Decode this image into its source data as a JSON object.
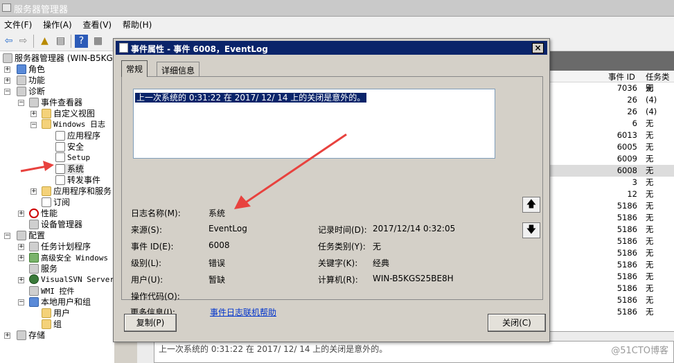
{
  "window": {
    "title": "服务器管理器"
  },
  "menu": [
    "文件(F)",
    "操作(A)",
    "查看(V)",
    "帮助(H)"
  ],
  "tree": {
    "root": "服务器管理器 (WIN-B5KGS2",
    "roles": "角色",
    "features": "功能",
    "diagnostics": "诊断",
    "event_viewer": "事件查看器",
    "custom_views": "自定义视图",
    "windows_logs": "Windows 日志",
    "application": "应用程序",
    "security": "安全",
    "setup": "Setup",
    "system": "系统",
    "forwarded": "转发事件",
    "apps_services": "应用程序和服务",
    "subscriptions": "订阅",
    "performance": "性能",
    "device_manager": "设备管理器",
    "configuration": "配置",
    "task_scheduler": "任务计划程序",
    "firewall": "高级安全 Windows",
    "services": "服务",
    "visualsvn": "VisualSVN Server",
    "wmi": "WMI 控件",
    "local_users": "本地用户和组",
    "users": "用户",
    "groups": "组",
    "storage": "存储"
  },
  "list": {
    "headers": {
      "event_id": "事件 ID",
      "category": "任务类别"
    },
    "rows": [
      {
        "id": "7036",
        "cat": "无"
      },
      {
        "id": "26",
        "cat": "(4)"
      },
      {
        "id": "26",
        "cat": "(4)"
      },
      {
        "id": "6",
        "cat": "无"
      },
      {
        "id": "6013",
        "cat": "无"
      },
      {
        "id": "6005",
        "cat": "无"
      },
      {
        "id": "6009",
        "cat": "无"
      },
      {
        "id": "6008",
        "cat": "无"
      },
      {
        "id": "3",
        "cat": "无"
      },
      {
        "id": "12",
        "cat": "无"
      },
      {
        "id": "5186",
        "cat": "无"
      },
      {
        "id": "5186",
        "cat": "无"
      },
      {
        "id": "5186",
        "cat": "无"
      },
      {
        "id": "5186",
        "cat": "无"
      },
      {
        "id": "5186",
        "cat": "无"
      },
      {
        "id": "5186",
        "cat": "无"
      },
      {
        "id": "5186",
        "cat": "无"
      },
      {
        "id": "5186",
        "cat": "无"
      },
      {
        "id": "5186",
        "cat": "无"
      },
      {
        "id": "5186",
        "cat": "无"
      }
    ]
  },
  "detail_preview": "上一次系统的 0:31:22 在  2017/  12/  14 上的关闭是意外的。",
  "dialog": {
    "title": "事件属性 - 事件 6008，EventLog",
    "close": "×",
    "tabs": [
      "常规",
      "详细信息"
    ],
    "description": "上一次系统的 0:31:22 在   2017/  12/  14 上的关闭是意外的。",
    "fields": {
      "log_name_label": "日志名称(M):",
      "log_name": "系统",
      "source_label": "来源(S):",
      "source": "EventLog",
      "logged_label": "记录时间(D):",
      "logged": "2017/12/14 0:32:05",
      "event_id_label": "事件 ID(E):",
      "event_id": "6008",
      "task_category_label": "任务类别(Y):",
      "task_category": "无",
      "level_label": "级别(L):",
      "level": "错误",
      "keywords_label": "关键字(K):",
      "keywords": "经典",
      "user_label": "用户(U):",
      "user": "暂缺",
      "computer_label": "计算机(R):",
      "computer": "WIN-B5KGS25BE8H",
      "opcode_label": "操作代码(O):",
      "more_info_label": "更多信息(I):",
      "more_info_link": "事件日志联机帮助"
    },
    "buttons": {
      "copy": "复制(P)",
      "close": "关闭(C)"
    }
  },
  "watermark": "@51CTO博客",
  "colors": {
    "title_bar": "#0a246a",
    "arrow": "#e8423e",
    "selection": "#0a246a"
  }
}
